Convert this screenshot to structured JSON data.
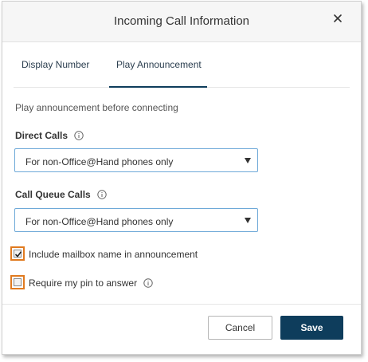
{
  "dialog": {
    "title": "Incoming Call Information",
    "close_icon": "close-icon"
  },
  "tabs": [
    {
      "label": "Display Number",
      "active": false
    },
    {
      "label": "Play Announcement",
      "active": true
    }
  ],
  "content": {
    "subtitle": "Play announcement before connecting",
    "direct_calls": {
      "label": "Direct Calls",
      "info_icon": "info-icon",
      "selected": "For non-Office@Hand phones only"
    },
    "call_queue_calls": {
      "label": "Call Queue Calls",
      "info_icon": "info-icon",
      "selected": "For non-Office@Hand phones only"
    },
    "include_mailbox": {
      "label": "Include mailbox name in announcement",
      "checked": true
    },
    "require_pin": {
      "label": "Require my pin to answer",
      "checked": false,
      "info_icon": "info-icon"
    }
  },
  "footer": {
    "cancel_label": "Cancel",
    "save_label": "Save"
  },
  "colors": {
    "primary": "#0e3d5c",
    "highlight": "#e07a1f",
    "select_border": "#6ea9d8"
  }
}
